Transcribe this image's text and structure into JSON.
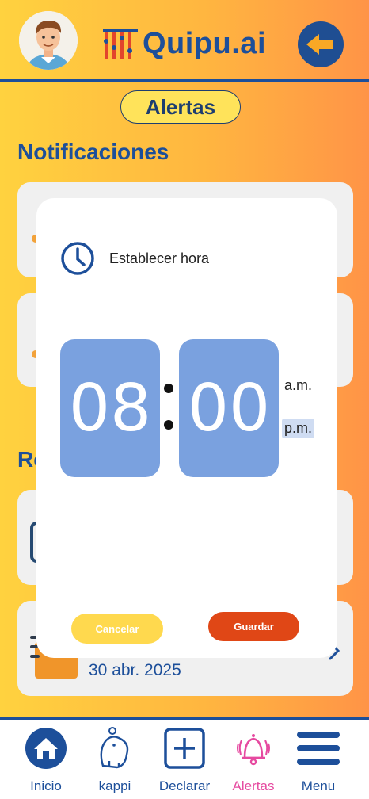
{
  "header": {
    "logo_text": "Quipu.ai",
    "avatar_icon": "user-avatar-icon",
    "back_icon": "arrow-left-icon"
  },
  "page": {
    "title": "Alertas",
    "section_notifications": "Notificaciones",
    "section_reminders_partial": "Re"
  },
  "cards": {
    "reminder_date": "30 abr. 2025"
  },
  "time_picker": {
    "title": "Establecer hora",
    "hour": "08",
    "minute": "00",
    "am_label": "a.m.",
    "pm_label": "p.m.",
    "selected_period": "p.m.",
    "cancel_label": "Cancelar",
    "save_label": "Guardar"
  },
  "nav": {
    "items": [
      {
        "label": "Inicio",
        "icon": "home-icon"
      },
      {
        "label": "kappi",
        "icon": "capybara-icon"
      },
      {
        "label": "Declarar",
        "icon": "plus-square-icon"
      },
      {
        "label": "Alertas",
        "icon": "bell-icon",
        "active": true
      },
      {
        "label": "Menu",
        "icon": "hamburger-menu-icon"
      }
    ]
  },
  "colors": {
    "brand_blue": "#1d4f9a",
    "active_pink": "#e64aa0",
    "save_orange": "#e04716",
    "cancel_yellow": "#ffd94e",
    "digit_blue": "#7aa1df"
  }
}
